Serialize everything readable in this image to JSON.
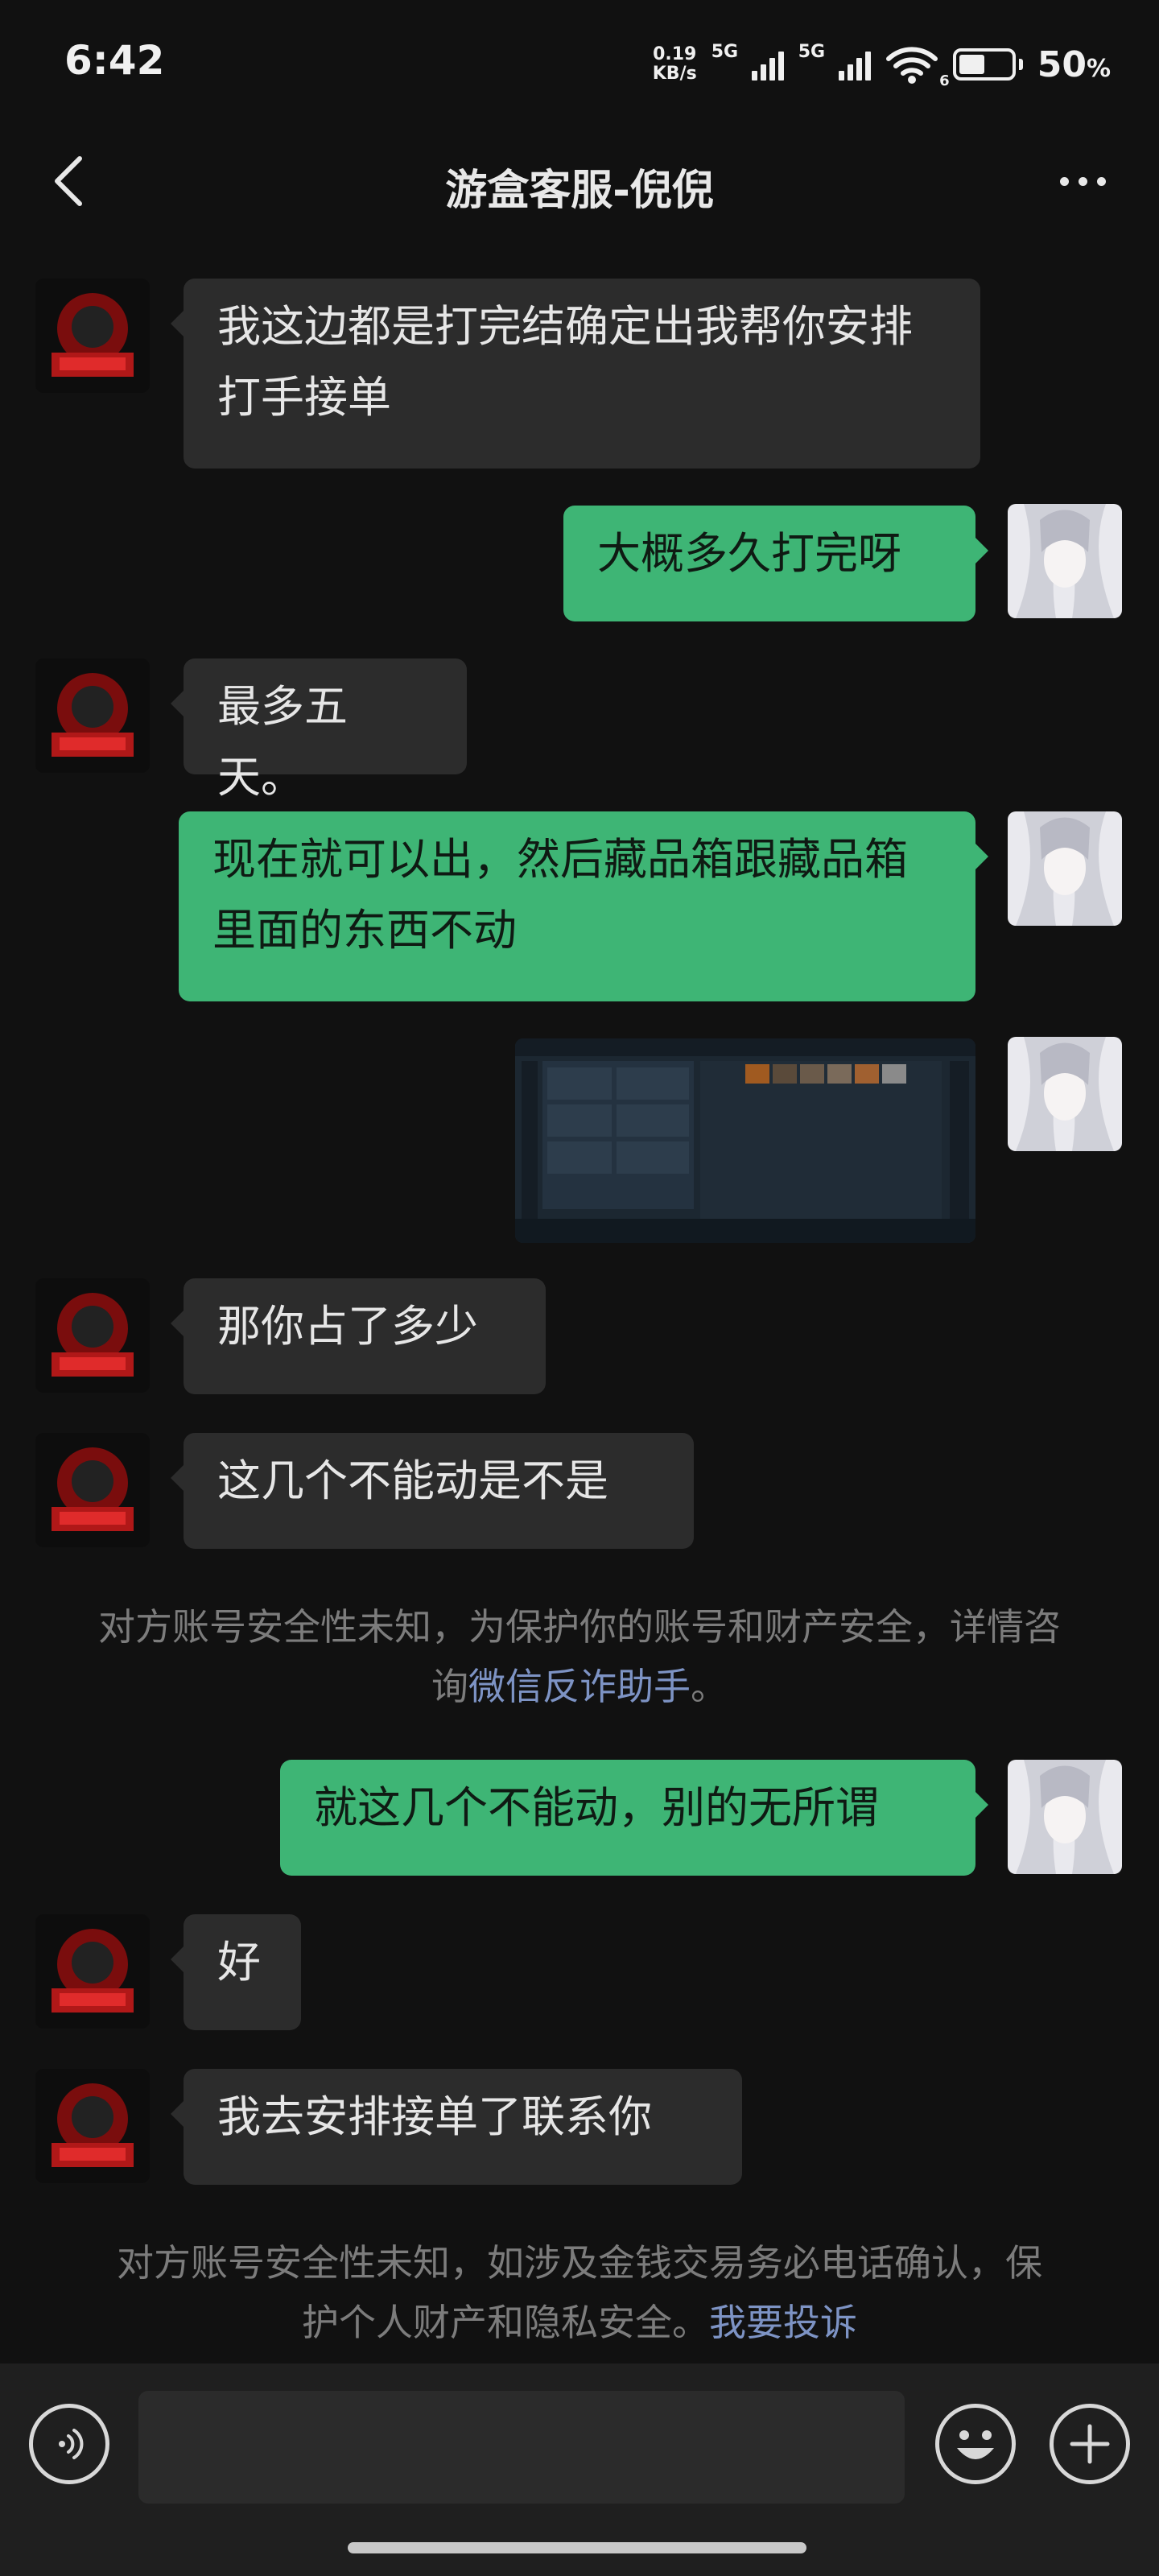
{
  "status_bar": {
    "time": "6:42",
    "net_speed_value": "0.19",
    "net_speed_unit": "KB/s",
    "sim1_label": "5G",
    "sim2_label": "5G",
    "wifi_label": "6",
    "battery_percent": "50",
    "battery_unit": "%",
    "battery_level": 0.5
  },
  "nav": {
    "title": "游盒客服-倪倪",
    "back_icon": "chevron-left-icon",
    "more_icon": "more-dots-icon"
  },
  "messages": [
    {
      "side": "in",
      "text": "我这边都是打完结确定出我帮你安排打手接单"
    },
    {
      "side": "out",
      "text": "大概多久打完呀"
    },
    {
      "side": "in",
      "text": "最多五天。"
    },
    {
      "side": "out",
      "text": "现在就可以出，然后藏品箱跟藏品箱里面的东西不动"
    },
    {
      "side": "out",
      "type": "image",
      "alt": "game-inventory-screenshot"
    },
    {
      "side": "in",
      "text": "那你占了多少"
    },
    {
      "side": "in",
      "text": "这几个不能动是不是"
    },
    {
      "side": "out",
      "text": "就这几个不能动，别的无所谓"
    },
    {
      "side": "in",
      "text": "好"
    },
    {
      "side": "in",
      "text": "我去安排接单了联系你"
    }
  ],
  "system_notes": [
    {
      "text": "对方账号安全性未知，为保护你的账号和财产安全，详情咨询",
      "link": "微信反诈助手",
      "suffix": "。"
    },
    {
      "text": "对方账号安全性未知，如涉及金钱交易务必电话确认，保护个人财产和隐私安全。",
      "link": "我要投诉",
      "suffix": ""
    }
  ],
  "input_bar": {
    "voice_icon": "voice-icon",
    "emoji_icon": "emoji-icon",
    "plus_icon": "plus-icon",
    "text": ""
  },
  "colors": {
    "background": "#111111",
    "bubble_in": "#2c2c2c",
    "bubble_out": "#3eb575",
    "link": "#7d93c4"
  }
}
